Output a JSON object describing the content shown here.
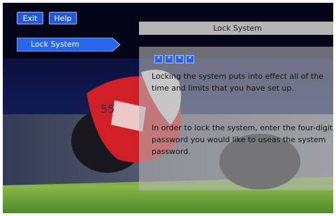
{
  "toolbar": {
    "exit_label": "Exit",
    "help_label": "Help"
  },
  "sidebar": {
    "items": [
      {
        "label": "Lock System"
      }
    ]
  },
  "panel": {
    "title": "Lock System",
    "password_boxes": [
      "*",
      "*",
      "*",
      "*"
    ],
    "paragraph1": "Locking the system puts into effect all of the time and limits that you have set up.",
    "paragraph2": "In order to lock the system, enter the four-digit password you would like to useas the system password."
  },
  "colors": {
    "accent": "#2358d8",
    "background": "#05051a",
    "panel": "#b5b5b5",
    "grass": "#6fa83a",
    "bike_red": "#d8222a"
  }
}
